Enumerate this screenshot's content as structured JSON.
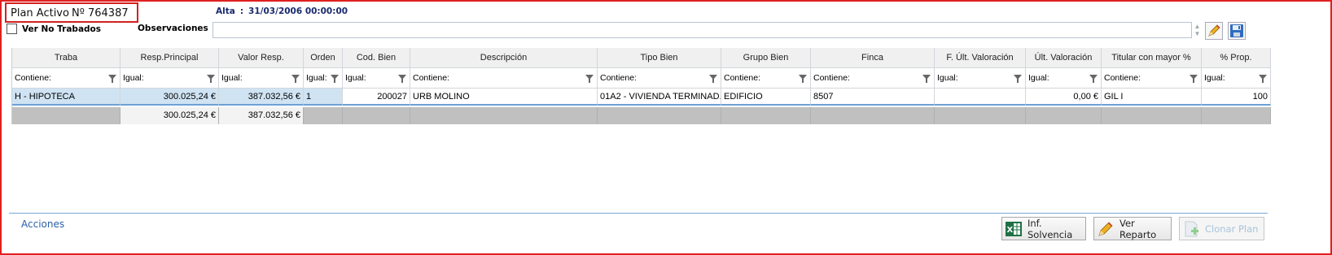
{
  "plan": {
    "label": "Plan Activo",
    "number": "Nº  764387"
  },
  "alta": {
    "label": "Alta",
    "sep": ":",
    "value": "31/03/2006 00:00:00"
  },
  "filters": {
    "ver_no_trabados": "Ver No Trabados"
  },
  "observaciones": {
    "label": "Observaciones",
    "value": ""
  },
  "grid": {
    "columns": [
      "Traba",
      "Resp.Principal",
      "Valor Resp.",
      "Orden",
      "Cod. Bien",
      "Descripción",
      "Tipo Bien",
      "Grupo Bien",
      "Finca",
      "F. Últ. Valoración",
      "Últ. Valoración",
      "Titular con mayor %",
      "% Prop."
    ],
    "filters": [
      "Contiene:",
      "Igual:",
      "Igual:",
      "Igual:",
      "Igual:",
      "Contiene:",
      "Contiene:",
      "Contiene:",
      "Contiene:",
      "Igual:",
      "Igual:",
      "Contiene:",
      "Igual:"
    ],
    "rows": [
      [
        "H - HIPOTECA",
        "300.025,24 €",
        "387.032,56 €",
        "1",
        "200027",
        "URB MOLINO",
        "01A2 - VIVIENDA TERMINAD...",
        "EDIFICIO",
        "8507",
        "",
        "0,00 €",
        "GIL I",
        "100"
      ]
    ],
    "totals": [
      "",
      "300.025,24 €",
      "387.032,56 €",
      "",
      "",
      "",
      "",
      "",
      "",
      "",
      "",
      "",
      ""
    ]
  },
  "footer": {
    "acciones": "Acciones",
    "buttons": {
      "inf_solvencia": "Inf. Solvencia",
      "ver_reparto": "Ver Reparto",
      "clonar_plan": "Clonar Plan"
    }
  },
  "colors": {
    "border_accent": "#e02020",
    "selection": "#cfe3f3",
    "link": "#2b5ea8",
    "excel_green": "#1e7145"
  }
}
